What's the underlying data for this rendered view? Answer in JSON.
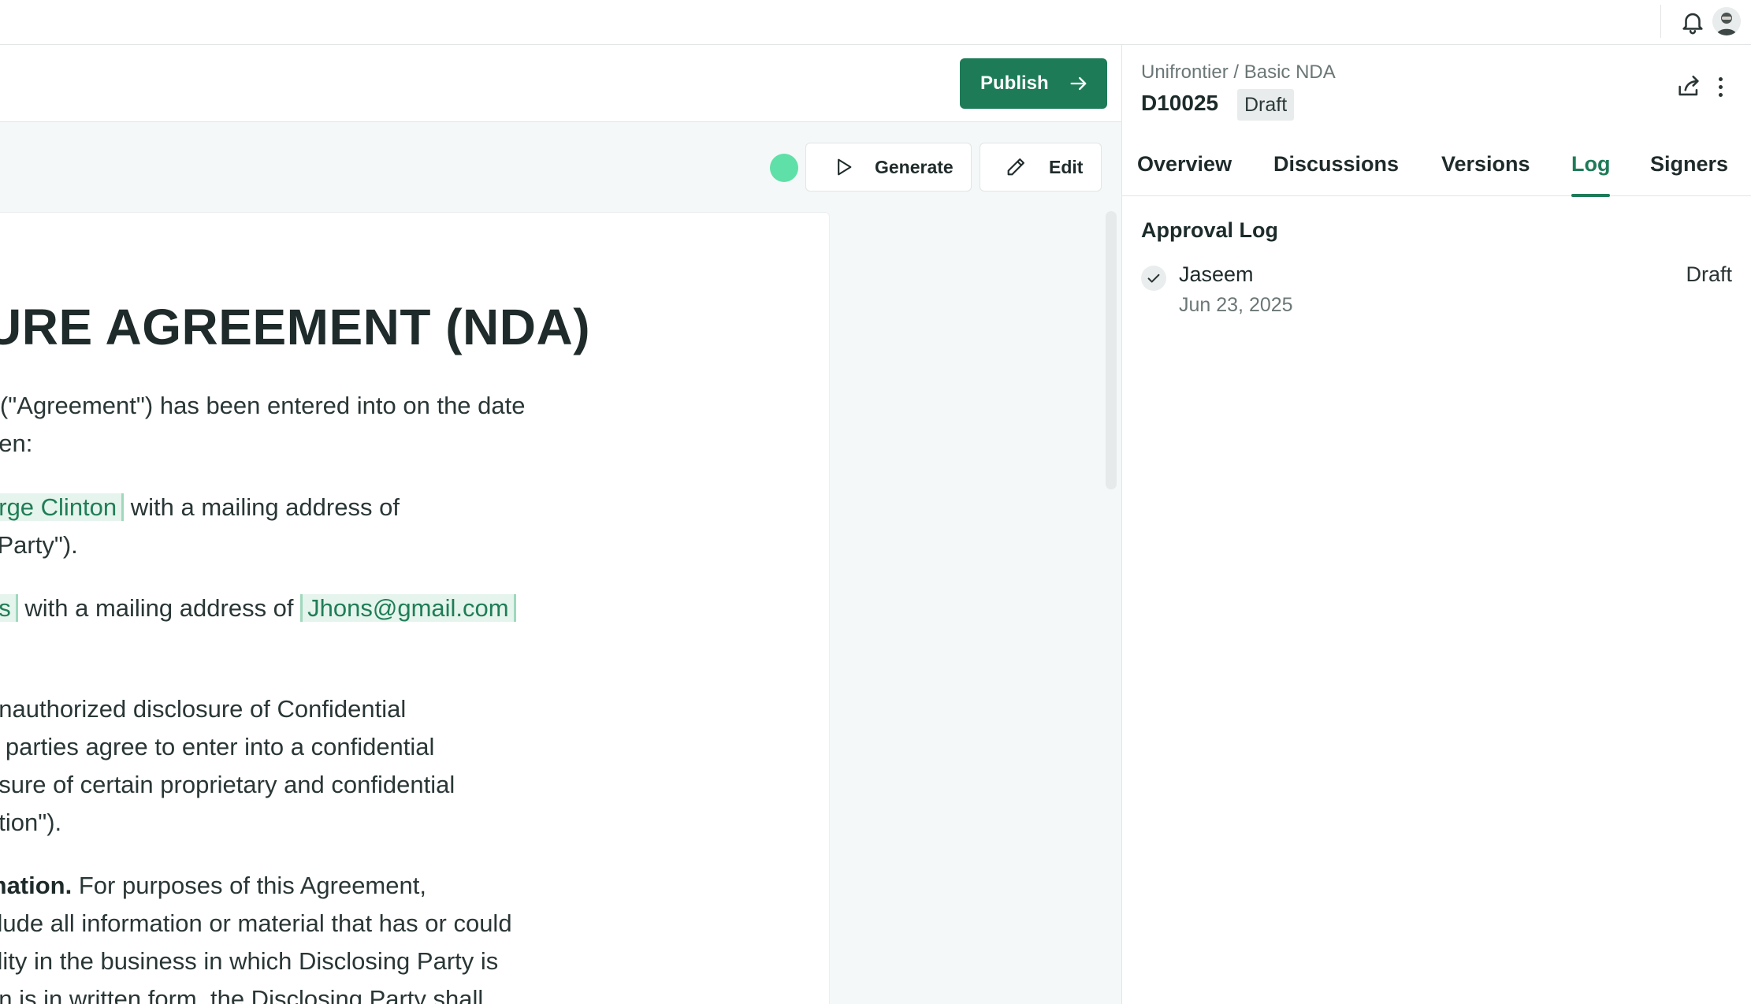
{
  "toolbar": {
    "publish_label": "Publish",
    "generate_label": "Generate",
    "edit_label": "Edit"
  },
  "document": {
    "title": "URE AGREEMENT (NDA)",
    "p1_l1": "r (\"Agreement\") has been entered into on the date",
    "p1_l2": "een:",
    "p2_field": "orge Clinton",
    "p2_l1_rest": " with a mailing address of",
    "p2_l2": "j Party\").",
    "p3_field1": "ns",
    "p3_mid": " with a mailing address of ",
    "p3_field2": "Jhons@gmail.com",
    "p4_l1": " unauthorized disclosure of Confidential",
    "p4_l2": "e parties agree to enter into a confidential",
    "p4_l3": "osure of certain proprietary and confidential",
    "p4_l4": "ation\").",
    "p5_term": "mation.",
    "p5_l1_rest": " For purposes of this Agreement,",
    "p5_l2": "clude all information or material that has or could",
    "p5_l3": "tility in the business in which Disclosing Party is",
    "p5_l4": "on is in written form, the Disclosing Party shall"
  },
  "panel": {
    "breadcrumb": "Unifrontier / Basic NDA",
    "doc_id": "D10025",
    "doc_status": "Draft",
    "tabs": [
      {
        "label": "Overview"
      },
      {
        "label": "Discussions"
      },
      {
        "label": "Versions"
      },
      {
        "label": "Log"
      },
      {
        "label": "Signers"
      }
    ],
    "active_tab": "Log",
    "approval_log": {
      "title": "Approval Log",
      "entries": [
        {
          "name": "Jaseem",
          "date": "Jun 23, 2025",
          "status": "Draft"
        }
      ]
    }
  },
  "colors": {
    "accent": "#1e7b58",
    "status_dot": "#5fe0a8",
    "highlight_bg": "#e5f4ec"
  },
  "icons": {
    "notifications": "bell-icon",
    "publish": "arrow-right-icon",
    "generate": "play-icon",
    "edit": "pencil-icon",
    "share": "share-icon",
    "more": "more-vertical-icon",
    "log_entry": "check-icon"
  }
}
